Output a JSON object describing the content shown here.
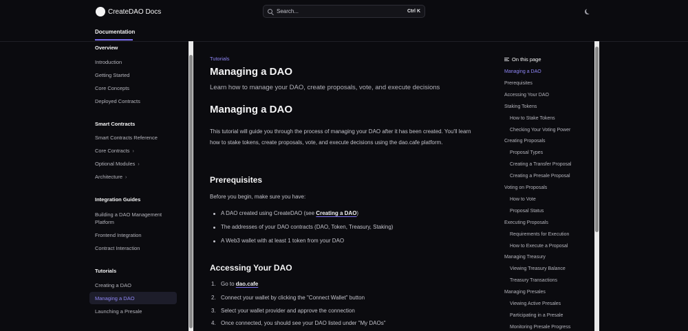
{
  "header": {
    "logo_text": "CreateDAO Docs",
    "search_placeholder": "Search...",
    "search_shortcut": "Ctrl K",
    "nav_tab": "Documentation"
  },
  "sidebar": {
    "sections": [
      {
        "title": "Overview",
        "items": [
          "Introduction",
          "Getting Started",
          "Core Concepts",
          "Deployed Contracts"
        ]
      },
      {
        "title": "Smart Contracts",
        "items": [
          "Smart Contracts Reference",
          "Core Contracts",
          "Optional Modules",
          "Architecture"
        ]
      },
      {
        "title": "Integration Guides",
        "items": [
          "Building a DAO Management Platform",
          "Frontend Integration",
          "Contract Interaction"
        ]
      },
      {
        "title": "Tutorials",
        "items": [
          "Creating a DAO",
          "Managing a DAO",
          "Launching a Presale"
        ]
      }
    ],
    "chevron": "›"
  },
  "main": {
    "breadcrumb": "Tutorials",
    "title": "Managing a DAO",
    "description": "Learn how to manage your DAO, create proposals, vote, and execute decisions",
    "h1": "Managing a DAO",
    "intro": "This tutorial will guide you through the process of managing your DAO after it has been created. You'll learn how to stake tokens, create proposals, vote, and execute decisions using the dao.cafe platform.",
    "prereq_heading": "Prerequisites",
    "prereq_intro": "Before you begin, make sure you have:",
    "prereq_items": {
      "item1_before": "A DAO created using CreateDAO (see ",
      "item1_link": "Creating a DAO",
      "item1_after": ")",
      "item2": "The addresses of your DAO contracts (DAO, Token, Treasury, Staking)",
      "item3": "A Web3 wallet with at least 1 token from your DAO"
    },
    "access_heading": "Accessing Your DAO",
    "steps": {
      "n1": "1.",
      "s1_before": "Go to ",
      "s1_link": "dao.cafe",
      "n2": "2.",
      "s2": "Connect your wallet by clicking the \"Connect Wallet\" button",
      "n3": "3.",
      "s3": "Select your wallet provider and approve the connection",
      "n4": "4.",
      "s4": "Once connected, you should see your DAO listed under \"My DAOs\""
    }
  },
  "toc": {
    "heading": "On this page",
    "items": [
      {
        "label": "Managing a DAO",
        "level": 1
      },
      {
        "label": "Prerequisites",
        "level": 1
      },
      {
        "label": "Accessing Your DAO",
        "level": 1
      },
      {
        "label": "Staking Tokens",
        "level": 1
      },
      {
        "label": "How to Stake Tokens",
        "level": 2
      },
      {
        "label": "Checking Your Voting Power",
        "level": 2
      },
      {
        "label": "Creating Proposals",
        "level": 1
      },
      {
        "label": "Proposal Types",
        "level": 2
      },
      {
        "label": "Creating a Transfer Proposal",
        "level": 2
      },
      {
        "label": "Creating a Presale Proposal",
        "level": 2
      },
      {
        "label": "Voting on Proposals",
        "level": 1
      },
      {
        "label": "How to Vote",
        "level": 2
      },
      {
        "label": "Proposal Status",
        "level": 2
      },
      {
        "label": "Executing Proposals",
        "level": 1
      },
      {
        "label": "Requirements for Execution",
        "level": 2
      },
      {
        "label": "How to Execute a Proposal",
        "level": 2
      },
      {
        "label": "Managing Treasury",
        "level": 1
      },
      {
        "label": "Viewing Treasury Balance",
        "level": 2
      },
      {
        "label": "Treasury Transactions",
        "level": 2
      },
      {
        "label": "Managing Presales",
        "level": 1
      },
      {
        "label": "Viewing Active Presales",
        "level": 2
      },
      {
        "label": "Participating in a Presale",
        "level": 2
      },
      {
        "label": "Monitoring Presale Progress",
        "level": 2
      }
    ]
  },
  "colors": {
    "background": "#0b0b0f",
    "accent": "#8e86f5",
    "active_bg": "#1d1d2a"
  }
}
